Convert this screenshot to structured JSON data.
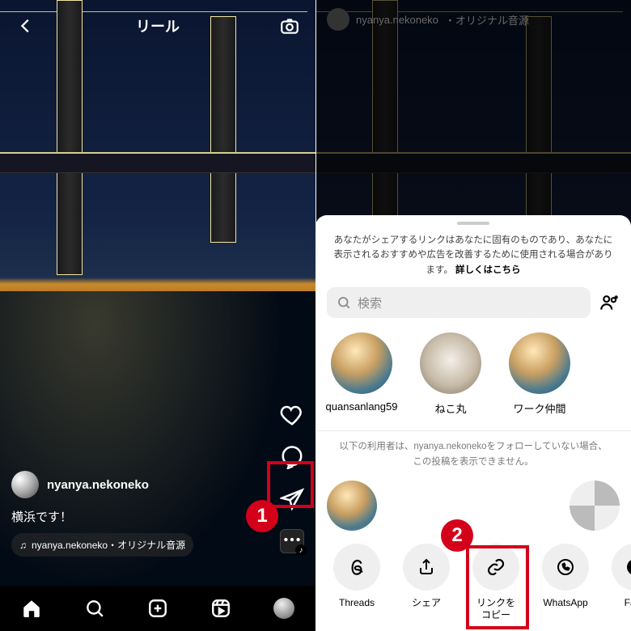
{
  "left": {
    "title": "リール",
    "username": "nyanya.nekoneko",
    "caption": "横浜です！",
    "audio_prefix": "♫",
    "audio": "nyanya.nekoneko・オリジナル音源"
  },
  "right": {
    "header_user": "nyanya.nekoneko",
    "header_tail": "・オリジナル音源",
    "disclaimer": "あなたがシェアするリンクはあなたに固有のものであり、あなたに表示されるおすすめや広告を改善するために使用される場合があります。",
    "disclaimer_more": "詳しくはこちら",
    "search_placeholder": "検索",
    "contacts": [
      {
        "name": "quansanlang59",
        "style": "anime"
      },
      {
        "name": "ねこ丸",
        "style": "cat"
      },
      {
        "name": "ワーク仲間",
        "style": "anime"
      }
    ],
    "follow_notice": "以下の利用者は、nyanya.nekonekoをフォローしていない場合、この投稿を表示できません。",
    "actions": [
      {
        "id": "threads",
        "label": "Threads"
      },
      {
        "id": "share",
        "label": "シェア"
      },
      {
        "id": "copylink",
        "label": "リンクを\nコピー"
      },
      {
        "id": "whatsapp",
        "label": "WhatsApp"
      },
      {
        "id": "facebook",
        "label": "Face"
      }
    ]
  },
  "callouts": {
    "one": "1",
    "two": "2"
  }
}
